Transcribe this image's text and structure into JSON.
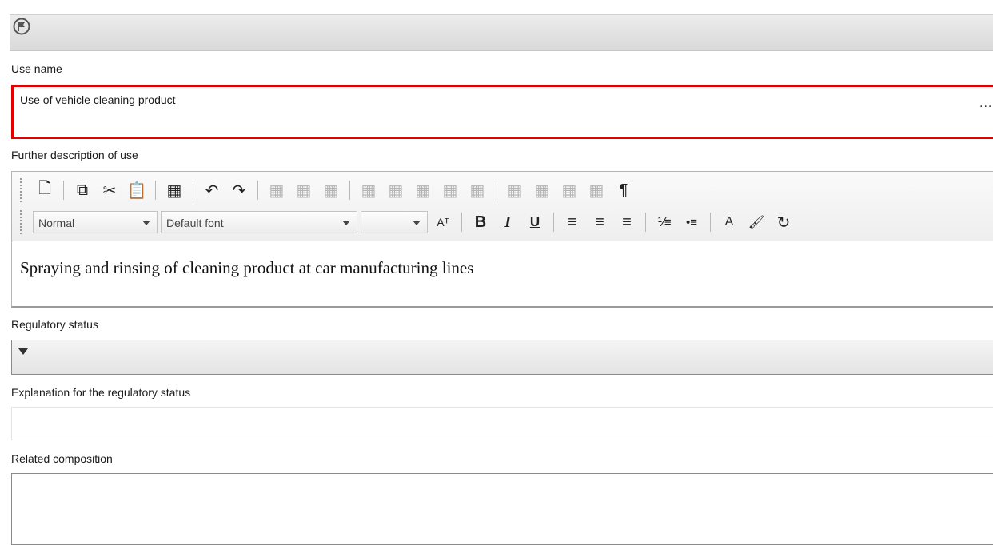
{
  "labels": {
    "use_name": "Use name",
    "further_description": "Further description of use",
    "regulatory_status": "Regulatory status",
    "explanation": "Explanation for the regulatory status",
    "related_composition": "Related composition"
  },
  "use_name": {
    "value": "Use of vehicle cleaning product",
    "more": "..."
  },
  "editor": {
    "style_value": "Normal",
    "font_value": "Default font",
    "size_value": "",
    "content": "Spraying and rinsing of cleaning product at car manufacturing lines",
    "glyphs": {
      "new": "🗋",
      "copy": "⧉",
      "cut": "✂",
      "paste": "📋",
      "table": "▦",
      "undo": "↶",
      "redo": "↷",
      "pilcrow": "¶",
      "font_size": "Aᵀ",
      "bold": "B",
      "italic": "I",
      "underline": "U",
      "align_left": "≡",
      "align_center": "≡",
      "align_right": "≡",
      "ordered_list": "⅟≡",
      "bullet_list": "•≡",
      "text_color": "A",
      "clear": "🖌",
      "refresh": "↻"
    }
  },
  "regulatory_status": {
    "value": ""
  },
  "explanation": {
    "value": ""
  },
  "related_composition": {
    "value": ""
  },
  "colors": {
    "required_border": "#e00000"
  }
}
